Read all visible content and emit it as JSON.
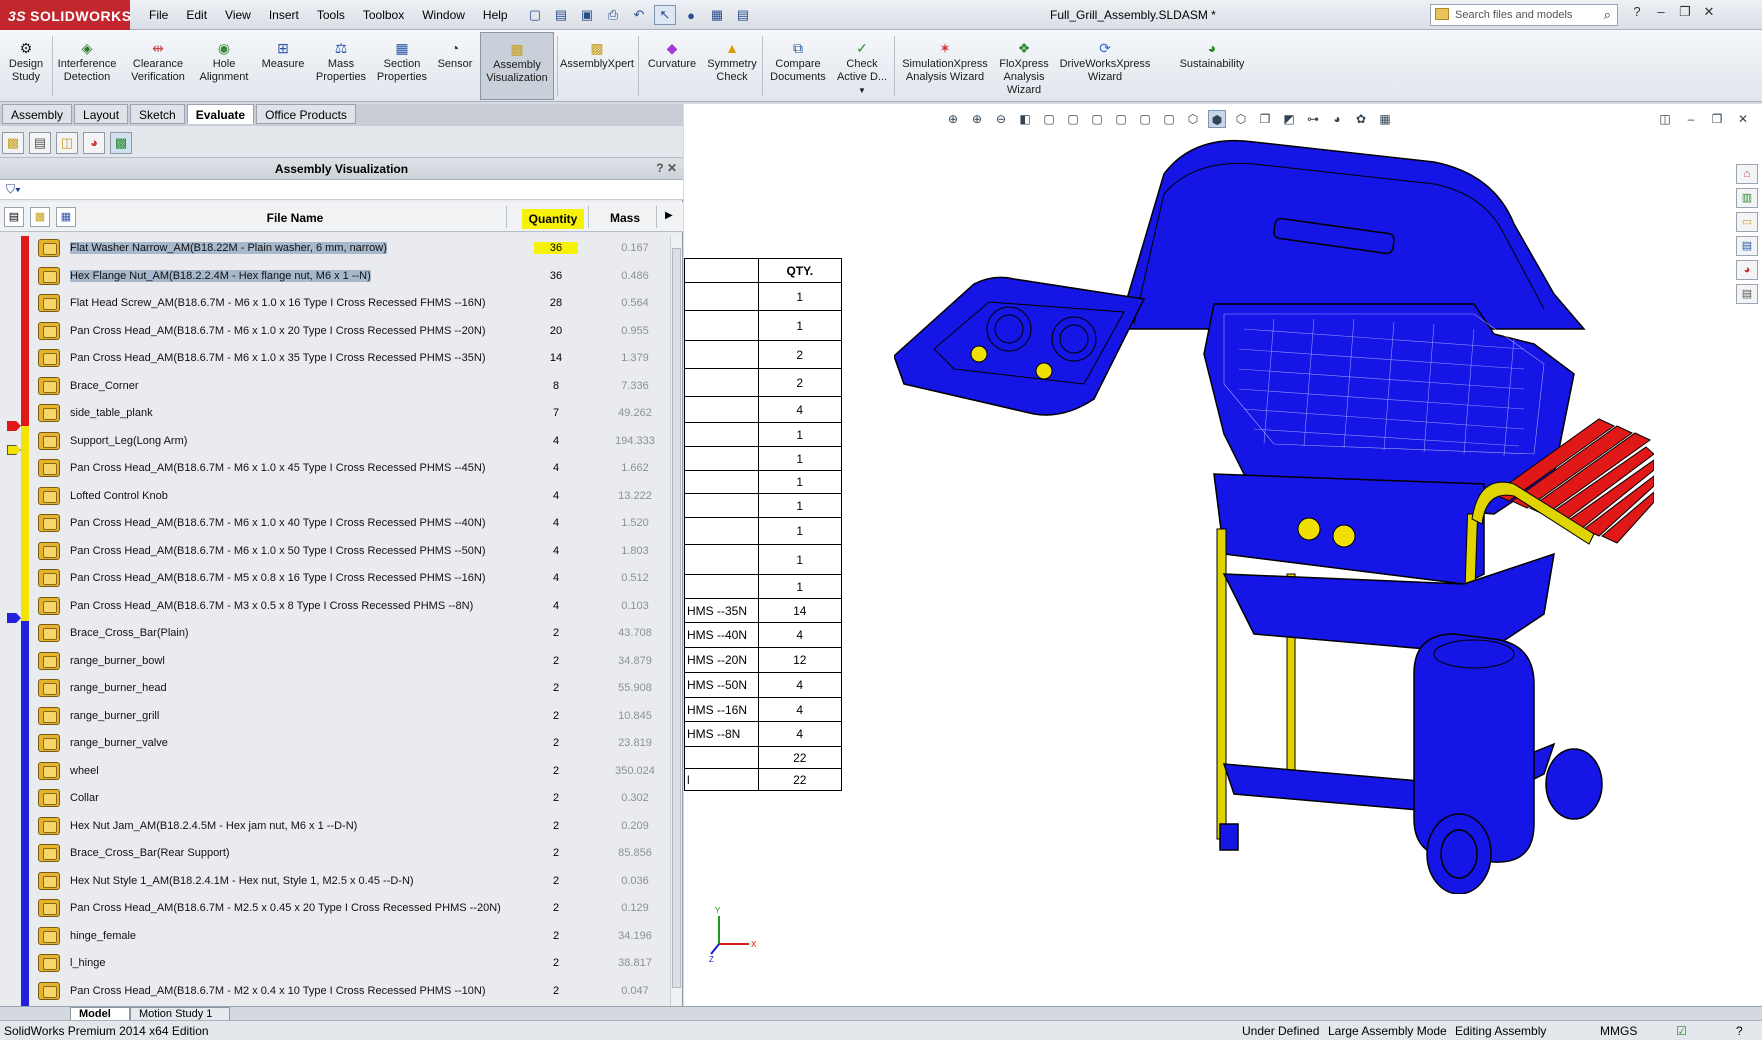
{
  "app": {
    "logo": "SOLIDWORKS",
    "logo_prefix": "3S",
    "doc_title": "Full_Grill_Assembly.SLDASM *",
    "search_placeholder": "Search files and models"
  },
  "menus": [
    "File",
    "Edit",
    "View",
    "Insert",
    "Tools",
    "Toolbox",
    "Window",
    "Help"
  ],
  "commands": [
    {
      "label": "Design Study",
      "icon": "design-study-icon"
    },
    {
      "label": "Interference Detection",
      "icon": "interference-icon"
    },
    {
      "label": "Clearance Verification",
      "icon": "clearance-icon"
    },
    {
      "label": "Hole Alignment",
      "icon": "hole-alignment-icon"
    },
    {
      "label": "Measure",
      "icon": "measure-icon"
    },
    {
      "label": "Mass Properties",
      "icon": "mass-properties-icon"
    },
    {
      "label": "Section Properties",
      "icon": "section-properties-icon"
    },
    {
      "label": "Sensor",
      "icon": "sensor-icon"
    },
    {
      "label": "Assembly Visualization",
      "icon": "assembly-visualization-icon"
    },
    {
      "label": "AssemblyXpert",
      "icon": "assemblyxpert-icon"
    },
    {
      "label": "Curvature",
      "icon": "curvature-icon"
    },
    {
      "label": "Symmetry Check",
      "icon": "symmetry-icon"
    },
    {
      "label": "Compare Documents",
      "icon": "compare-icon"
    },
    {
      "label": "Check Active D...",
      "icon": "check-icon"
    },
    {
      "label": "SimulationXpress Analysis Wizard",
      "icon": "simulation-icon"
    },
    {
      "label": "FloXpress Analysis Wizard",
      "icon": "floxpress-icon"
    },
    {
      "label": "DriveWorksXpress Wizard",
      "icon": "driveworks-icon"
    },
    {
      "label": "Sustainability",
      "icon": "sustainability-icon"
    }
  ],
  "tabs": [
    "Assembly",
    "Layout",
    "Sketch",
    "Evaluate",
    "Office Products"
  ],
  "active_tab": "Evaluate",
  "panel": {
    "title": "Assembly Visualization",
    "controls": "? ✕",
    "col_file": "File Name",
    "col_qty": "Quantity",
    "col_mass": "Mass"
  },
  "rows": [
    {
      "name": "Flat Washer Narrow_AM(B18.22M - Plain washer, 6 mm, narrow)",
      "qty": "36",
      "mass": "0.167"
    },
    {
      "name": "Hex Flange Nut_AM(B18.2.2.4M - Hex flange nut, M6 x 1 --N)",
      "qty": "36",
      "mass": "0.486"
    },
    {
      "name": "Flat Head Screw_AM(B18.6.7M - M6 x 1.0 x 16 Type I Cross Recessed FHMS --16N)",
      "qty": "28",
      "mass": "0.564"
    },
    {
      "name": "Pan Cross Head_AM(B18.6.7M - M6 x 1.0 x 20 Type I Cross Recessed PHMS --20N)",
      "qty": "20",
      "mass": "0.955"
    },
    {
      "name": "Pan Cross Head_AM(B18.6.7M - M6 x 1.0 x 35 Type I Cross Recessed PHMS --35N)",
      "qty": "14",
      "mass": "1.379"
    },
    {
      "name": "Brace_Corner",
      "qty": "8",
      "mass": "7.336"
    },
    {
      "name": "side_table_plank",
      "qty": "7",
      "mass": "49.262"
    },
    {
      "name": "Support_Leg(Long Arm)",
      "qty": "4",
      "mass": "194.333"
    },
    {
      "name": "Pan Cross Head_AM(B18.6.7M - M6 x 1.0 x 45 Type I Cross Recessed PHMS --45N)",
      "qty": "4",
      "mass": "1.662"
    },
    {
      "name": "Lofted Control Knob",
      "qty": "4",
      "mass": "13.222"
    },
    {
      "name": "Pan Cross Head_AM(B18.6.7M - M6 x 1.0 x 40 Type I Cross Recessed PHMS --40N)",
      "qty": "4",
      "mass": "1.520"
    },
    {
      "name": "Pan Cross Head_AM(B18.6.7M - M6 x 1.0 x 50 Type I Cross Recessed PHMS --50N)",
      "qty": "4",
      "mass": "1.803"
    },
    {
      "name": "Pan Cross Head_AM(B18.6.7M - M5 x 0.8 x 16 Type I Cross Recessed PHMS --16N)",
      "qty": "4",
      "mass": "0.512"
    },
    {
      "name": "Pan Cross Head_AM(B18.6.7M - M3 x 0.5 x 8 Type I Cross Recessed PHMS --8N)",
      "qty": "4",
      "mass": "0.103"
    },
    {
      "name": "Brace_Cross_Bar(Plain)",
      "qty": "2",
      "mass": "43.708"
    },
    {
      "name": "range_burner_bowl",
      "qty": "2",
      "mass": "34.879"
    },
    {
      "name": "range_burner_head",
      "qty": "2",
      "mass": "55.908"
    },
    {
      "name": "range_burner_grill",
      "qty": "2",
      "mass": "10.845"
    },
    {
      "name": "range_burner_valve",
      "qty": "2",
      "mass": "23.819"
    },
    {
      "name": "wheel",
      "qty": "2",
      "mass": "350.024"
    },
    {
      "name": "Collar",
      "qty": "2",
      "mass": "0.302"
    },
    {
      "name": "Hex Nut Jam_AM(B18.2.4.5M - Hex jam nut,  M6 x 1 --D-N)",
      "qty": "2",
      "mass": "0.209"
    },
    {
      "name": "Brace_Cross_Bar(Rear Support)",
      "qty": "2",
      "mass": "85.856"
    },
    {
      "name": "Hex Nut Style 1_AM(B18.2.4.1M - Hex nut, Style 1,  M2.5 x 0.45 --D-N)",
      "qty": "2",
      "mass": "0.036"
    },
    {
      "name": "Pan Cross Head_AM(B18.6.7M - M2.5 x 0.45 x 20 Type I Cross Recessed PHMS --20N)",
      "qty": "2",
      "mass": "0.129"
    },
    {
      "name": "hinge_female",
      "qty": "2",
      "mass": "34.196"
    },
    {
      "name": "l_hinge",
      "qty": "2",
      "mass": "38.817"
    },
    {
      "name": "Pan Cross Head_AM(B18.6.7M - M2 x 0.4 x 10 Type I Cross Recessed PHMS --10N)",
      "qty": "2",
      "mass": "0.047"
    }
  ],
  "bom": {
    "header": "QTY.",
    "rows": [
      {
        "n": "",
        "q": "1"
      },
      {
        "n": "",
        "q": "1"
      },
      {
        "n": "",
        "q": "2"
      },
      {
        "n": "",
        "q": "2"
      },
      {
        "n": "",
        "q": "4"
      },
      {
        "n": "",
        "q": "1"
      },
      {
        "n": "",
        "q": "1"
      },
      {
        "n": "",
        "q": "1"
      },
      {
        "n": "",
        "q": "1"
      },
      {
        "n": "",
        "q": "1"
      },
      {
        "n": "",
        "q": "1"
      },
      {
        "n": "",
        "q": "1"
      },
      {
        "n": "HMS --35N",
        "q": "14"
      },
      {
        "n": "HMS --40N",
        "q": "4"
      },
      {
        "n": "HMS --20N",
        "q": "12"
      },
      {
        "n": "HMS --50N",
        "q": "4"
      },
      {
        "n": "HMS --16N",
        "q": "4"
      },
      {
        "n": "HMS --8N",
        "q": "4"
      },
      {
        "n": "",
        "q": "22"
      },
      {
        "n": "l",
        "q": "22"
      }
    ]
  },
  "bottom_tabs": [
    "Model",
    "Motion Study 1"
  ],
  "status": {
    "edition": "SolidWorks Premium 2014 x64 Edition",
    "state": "Under Defined",
    "mode": "Large Assembly Mode",
    "editing": "Editing Assembly",
    "units": "MMGS"
  },
  "colors": {
    "brand": "#c1272d",
    "highlight": "#f5f10a",
    "selection": "#a8b8cc",
    "red": "#e01818",
    "yellow": "#f2e400",
    "blue": "#2222dd"
  }
}
